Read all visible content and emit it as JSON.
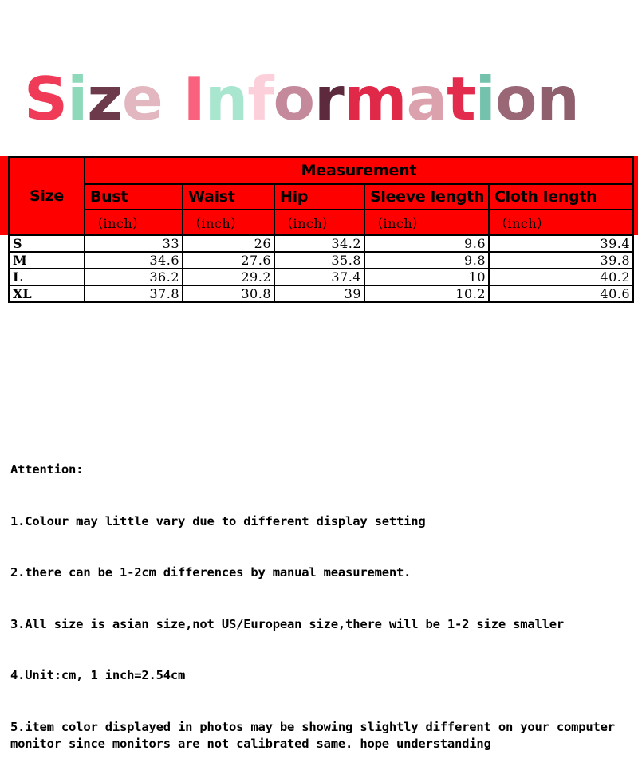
{
  "title": {
    "text": "Size Information",
    "letters": [
      {
        "ch": "S",
        "color": "#ef3b57"
      },
      {
        "ch": "i",
        "color": "#8fd9bb"
      },
      {
        "ch": "z",
        "color": "#6d3a4c"
      },
      {
        "ch": "e",
        "color": "#e3b7c0"
      },
      {
        "ch": " ",
        "color": "#ffffff"
      },
      {
        "ch": "I",
        "color": "#f9617f"
      },
      {
        "ch": "n",
        "color": "#a8e6cf"
      },
      {
        "ch": "f",
        "color": "#fbd0da"
      },
      {
        "ch": "o",
        "color": "#c48a9c"
      },
      {
        "ch": "r",
        "color": "#5c2a3c"
      },
      {
        "ch": "m",
        "color": "#e02848"
      },
      {
        "ch": "a",
        "color": "#dba2ad"
      },
      {
        "ch": "t",
        "color": "#e32b4d"
      },
      {
        "ch": "i",
        "color": "#74c2ab"
      },
      {
        "ch": "o",
        "color": "#9a6776"
      },
      {
        "ch": "n",
        "color": "#8f5f6e"
      }
    ]
  },
  "table": {
    "header_bg": "#ff0000",
    "border_color": "#000000",
    "size_header": "Size",
    "measurement_header": "Measurement",
    "columns": [
      {
        "name": "Bust",
        "unit": "（inch）"
      },
      {
        "name": "Waist",
        "unit": "（inch）"
      },
      {
        "name": "Hip",
        "unit": "（inch）"
      },
      {
        "name": "Sleeve length",
        "unit": "（inch）"
      },
      {
        "name": "Cloth length",
        "unit": "（inch）"
      }
    ],
    "rows": [
      {
        "size": "S",
        "bust": "33",
        "waist": "26",
        "hip": "34.2",
        "sleeve": "9.6",
        "cloth": "39.4"
      },
      {
        "size": "M",
        "bust": "34.6",
        "waist": "27.6",
        "hip": "35.8",
        "sleeve": "9.8",
        "cloth": "39.8"
      },
      {
        "size": "L",
        "bust": "36.2",
        "waist": "29.2",
        "hip": "37.4",
        "sleeve": "10",
        "cloth": "40.2"
      },
      {
        "size": "XL",
        "bust": "37.8",
        "waist": "30.8",
        "hip": "39",
        "sleeve": "10.2",
        "cloth": "40.6"
      }
    ]
  },
  "attention": {
    "heading": "Attention:",
    "lines": [
      "1.Colour may little vary due to different display setting",
      "2.there can be 1-2cm differences by manual measurement.",
      "3.All size is asian size,not US/European size,there will be 1-2 size smaller",
      "4.Unit:cm, 1 inch=2.54cm",
      "5.item color displayed in photos may be showing slightly different on your computer monitor since monitors are not calibrated same. hope understanding"
    ]
  }
}
